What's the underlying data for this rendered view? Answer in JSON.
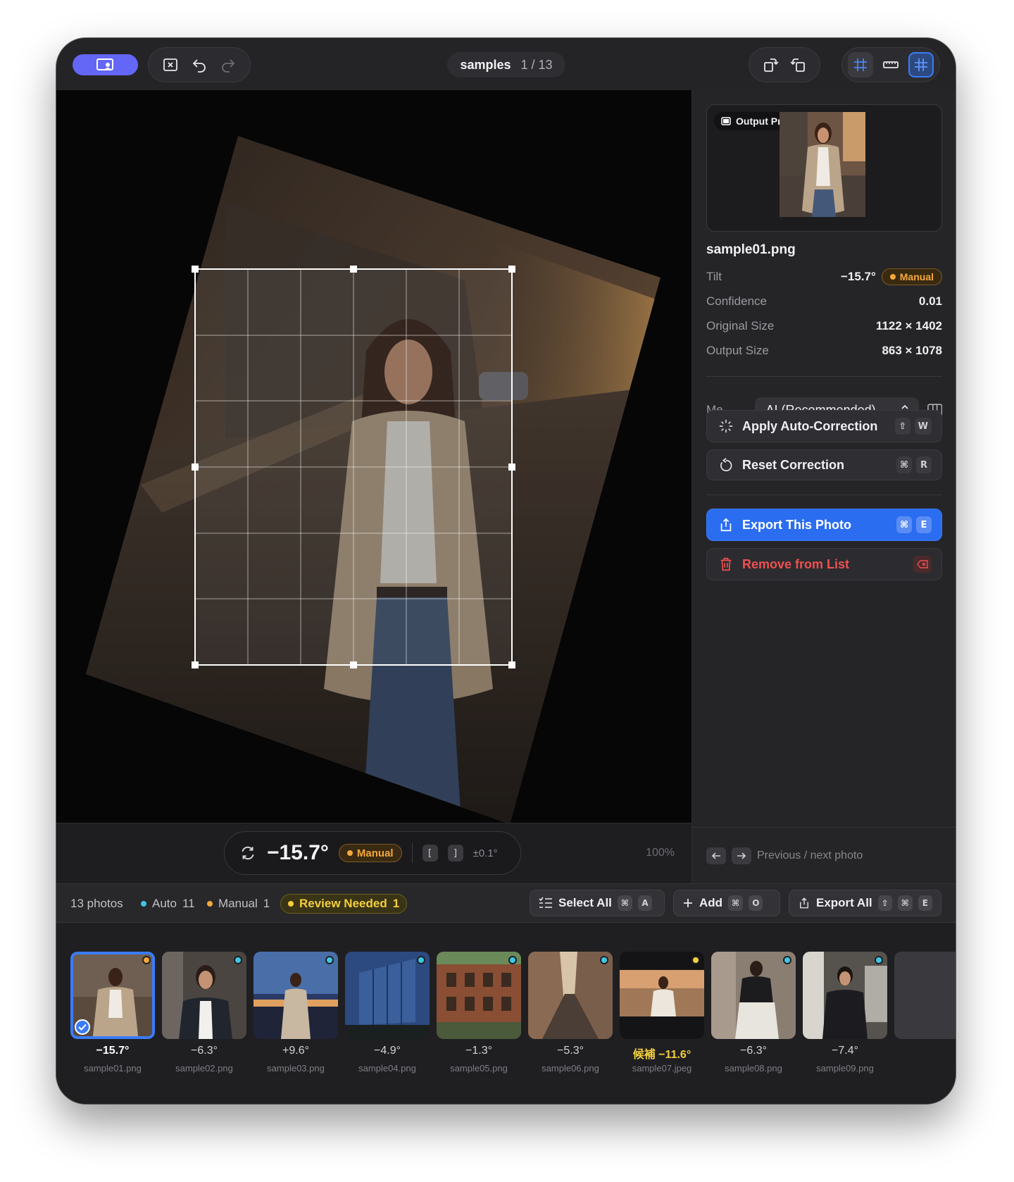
{
  "toolbar": {
    "title": "samples",
    "position": "1 / 13"
  },
  "canvas": {
    "angle": "−15.7°",
    "badge": "Manual",
    "bracket_left": "[",
    "bracket_right": "]",
    "step": "±0.1°",
    "zoom": "100%"
  },
  "sidebar": {
    "preview_label": "Output Preview",
    "filename": "sample01.png",
    "rows": [
      {
        "key": "Tilt",
        "value": "−15.7°",
        "badge": "Manual"
      },
      {
        "key": "Confidence",
        "value": "0.01"
      },
      {
        "key": "Original Size",
        "value": "1122 × 1402"
      },
      {
        "key": "Output Size",
        "value": "863 × 1078"
      }
    ],
    "method_label": "Me...",
    "method_value": "AI (Recommended)",
    "apply": {
      "label": "Apply Auto-Correction",
      "keys": [
        "⇧",
        "W"
      ]
    },
    "reset": {
      "label": "Reset Correction",
      "keys": [
        "⌘",
        "R"
      ]
    },
    "export": {
      "label": "Export This Photo",
      "keys": [
        "⌘",
        "E"
      ]
    },
    "remove": {
      "label": "Remove from List"
    },
    "footer_text": "Previous / next photo"
  },
  "statusbar": {
    "photos": "13 photos",
    "auto_label": "Auto",
    "auto_count": "11",
    "manual_label": "Manual",
    "manual_count": "1",
    "review_label": "Review Needed",
    "review_count": "1",
    "select_all": {
      "label": "Select All",
      "keys": [
        "⌘",
        "A"
      ]
    },
    "add": {
      "label": "Add",
      "keys": [
        "⌘",
        "O"
      ]
    },
    "export_all": {
      "label": "Export All",
      "keys": [
        "⇧",
        "⌘",
        "E"
      ]
    }
  },
  "thumbnails": [
    {
      "angle": "−15.7°",
      "name": "sample01.png",
      "status": "manual"
    },
    {
      "angle": "−6.3°",
      "name": "sample02.png",
      "status": "auto"
    },
    {
      "angle": "+9.6°",
      "name": "sample03.png",
      "status": "auto"
    },
    {
      "angle": "−4.9°",
      "name": "sample04.png",
      "status": "auto"
    },
    {
      "angle": "−1.3°",
      "name": "sample05.png",
      "status": "auto"
    },
    {
      "angle": "−5.3°",
      "name": "sample06.png",
      "status": "auto"
    },
    {
      "angle": "候補 −11.6°",
      "name": "sample07.jpeg",
      "status": "review"
    },
    {
      "angle": "−6.3°",
      "name": "sample08.png",
      "status": "auto"
    },
    {
      "angle": "−7.4°",
      "name": "sample09.png",
      "status": "auto"
    }
  ],
  "colors": {
    "accent": "#2b6df0",
    "auto": "#3fc7e6",
    "manual": "#f5a83c",
    "review": "#f4cf3c",
    "danger": "#ef5050"
  },
  "icons": [
    "display-user-icon",
    "close-square-icon",
    "undo-icon",
    "redo-icon",
    "rotate-left-icon",
    "rotate-right-icon",
    "crop-grid-icon",
    "ruler-icon",
    "grid-icon",
    "rotate-icon",
    "sparkle-icon",
    "reset-icon",
    "share-icon",
    "trash-icon",
    "delete-key-icon",
    "chevron-updown-icon",
    "columns-icon",
    "arrow-left-icon",
    "arrow-right-icon",
    "checklist-icon",
    "plus-icon",
    "checkmark-icon",
    "preview-icon"
  ]
}
